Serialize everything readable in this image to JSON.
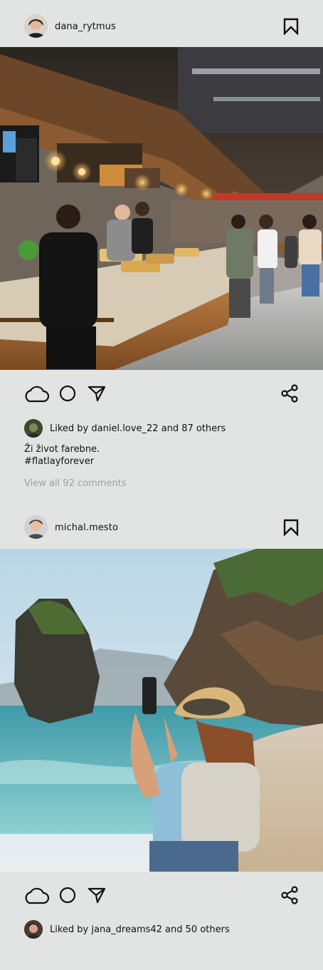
{
  "posts": [
    {
      "username": "dana_rytmus",
      "liked_by_user": "daniel.love_22",
      "liked_by_label": "Liked by daniel.love_22 and 87 others",
      "caption_line1": "Ži život farebne.",
      "caption_line2": "#flatlayforever",
      "view_comments": "View all 92 comments",
      "image": "food court interior with counters and people"
    },
    {
      "username": "michal.mesto",
      "liked_by_user": "jana_dreams42",
      "liked_by_label": "Liked by jana_dreams42 and 50 others",
      "image": "woman with straw hat taking a phone photo on a beach"
    }
  ],
  "icons": {
    "like": "cloud-icon",
    "comment": "circle-icon",
    "share_send": "send-icon",
    "share": "share-icon",
    "save": "bookmark-icon"
  },
  "colors": {
    "background": "#e2e4e4",
    "text": "#111111",
    "muted": "#9aa0a0"
  }
}
